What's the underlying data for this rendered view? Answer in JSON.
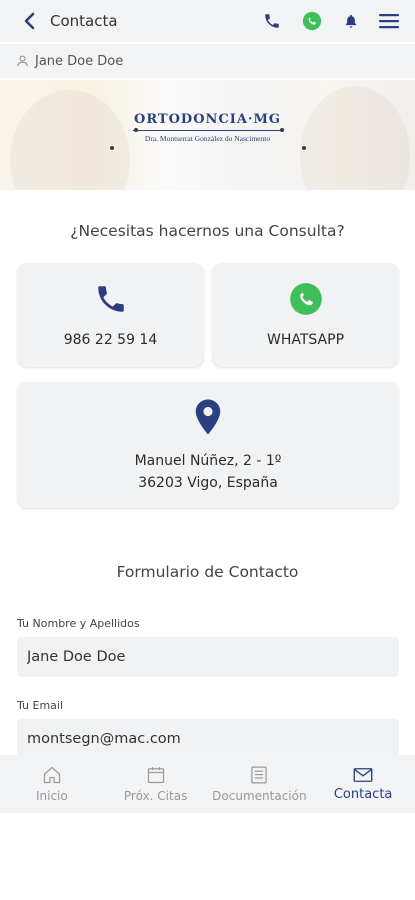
{
  "header": {
    "title": "Contacta",
    "icons": [
      "back-icon",
      "phone-icon",
      "whatsapp-icon",
      "bell-icon",
      "menu-icon"
    ]
  },
  "user": {
    "name": "Jane Doe Doe"
  },
  "banner": {
    "brand": "ORTODONCIA·MG",
    "doctor": "Dra. Montserrat González do Nascimento"
  },
  "contact": {
    "question": "¿Necesitas hacernos una Consulta?",
    "phone": "986 22 59 14",
    "whatsapp": "WHATSAPP",
    "address_line1": "Manuel Núñez, 2 - 1º",
    "address_line2": "36203 Vigo, España"
  },
  "form": {
    "title": "Formulario de Contacto",
    "name_label": "Tu Nombre y Apellidos",
    "name_value": "Jane Doe Doe",
    "email_label": "Tu Email",
    "email_value": "montsegn@mac.com"
  },
  "tabs": [
    {
      "label": "Inicio",
      "icon": "home-icon",
      "active": false
    },
    {
      "label": "Próx. Citas",
      "icon": "calendar-icon",
      "active": false
    },
    {
      "label": "Documentación",
      "icon": "document-list-icon",
      "active": false
    },
    {
      "label": "Contacta",
      "icon": "mail-icon",
      "active": true
    }
  ],
  "colors": {
    "accent": "#2a3f80",
    "whatsapp": "#3fbf5a",
    "card_bg": "#f1f2f3",
    "bar_bg": "#f2f3f5",
    "inactive_tab": "#9a9a9a"
  }
}
